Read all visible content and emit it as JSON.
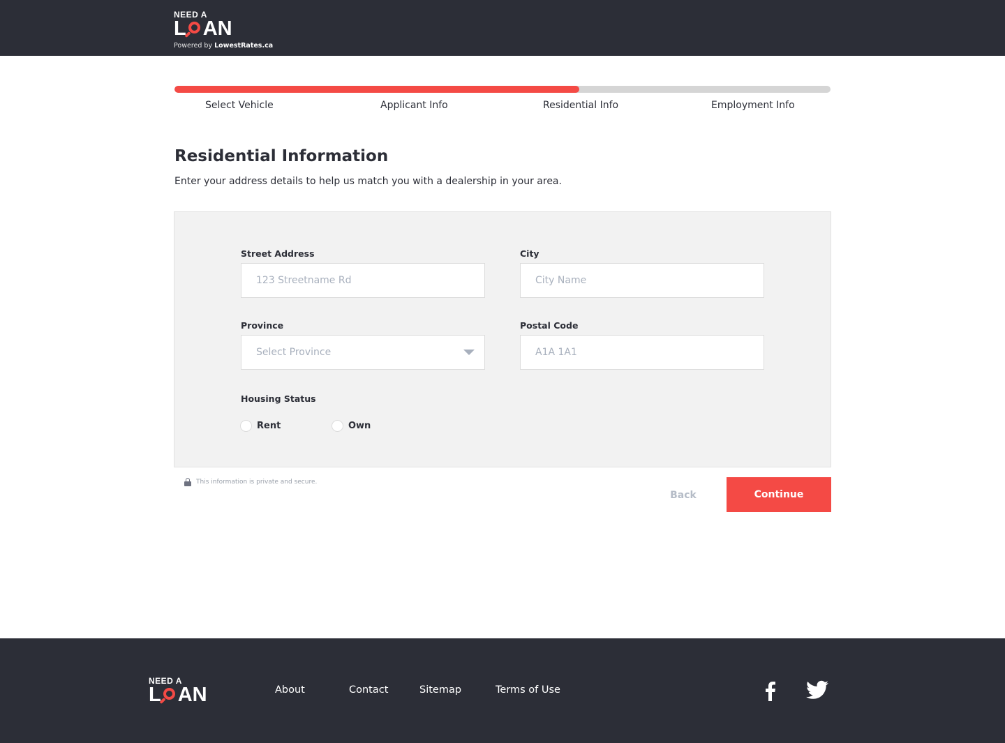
{
  "brand": {
    "need_a": "NEED A",
    "loan_l": "L",
    "loan_an": "AN",
    "powered_prefix": "Powered by",
    "powered_brand": "LowestRates.ca",
    "accent_color": "#f44a45",
    "dark_color": "#2c2e37"
  },
  "progress": {
    "fraction": 0.617,
    "steps": [
      {
        "label": "Select Vehicle"
      },
      {
        "label": "Applicant Info"
      },
      {
        "label": "Residential Info"
      },
      {
        "label": "Employment Info"
      }
    ]
  },
  "page": {
    "title": "Residential Information",
    "subtitle": "Enter your address details to help us match you with a dealership in your area."
  },
  "form": {
    "street": {
      "label": "Street Address",
      "placeholder": "123 Streetname Rd",
      "value": ""
    },
    "city": {
      "label": "City",
      "placeholder": "City Name",
      "value": ""
    },
    "province": {
      "label": "Province",
      "placeholder": "Select Province"
    },
    "postal": {
      "label": "Postal Code",
      "placeholder": "A1A 1A1",
      "value": ""
    },
    "housing": {
      "label": "Housing Status",
      "options": [
        {
          "label": "Rent",
          "selected": false
        },
        {
          "label": "Own",
          "selected": false
        }
      ]
    }
  },
  "secure_note": "This information is private and secure.",
  "actions": {
    "back_label": "Back",
    "continue_label": "Continue"
  },
  "footer": {
    "links": [
      {
        "label": "About"
      },
      {
        "label": "Contact"
      },
      {
        "label": "Sitemap"
      },
      {
        "label": "Terms of Use"
      }
    ],
    "social": [
      {
        "icon": "facebook-icon"
      },
      {
        "icon": "twitter-icon"
      }
    ]
  }
}
